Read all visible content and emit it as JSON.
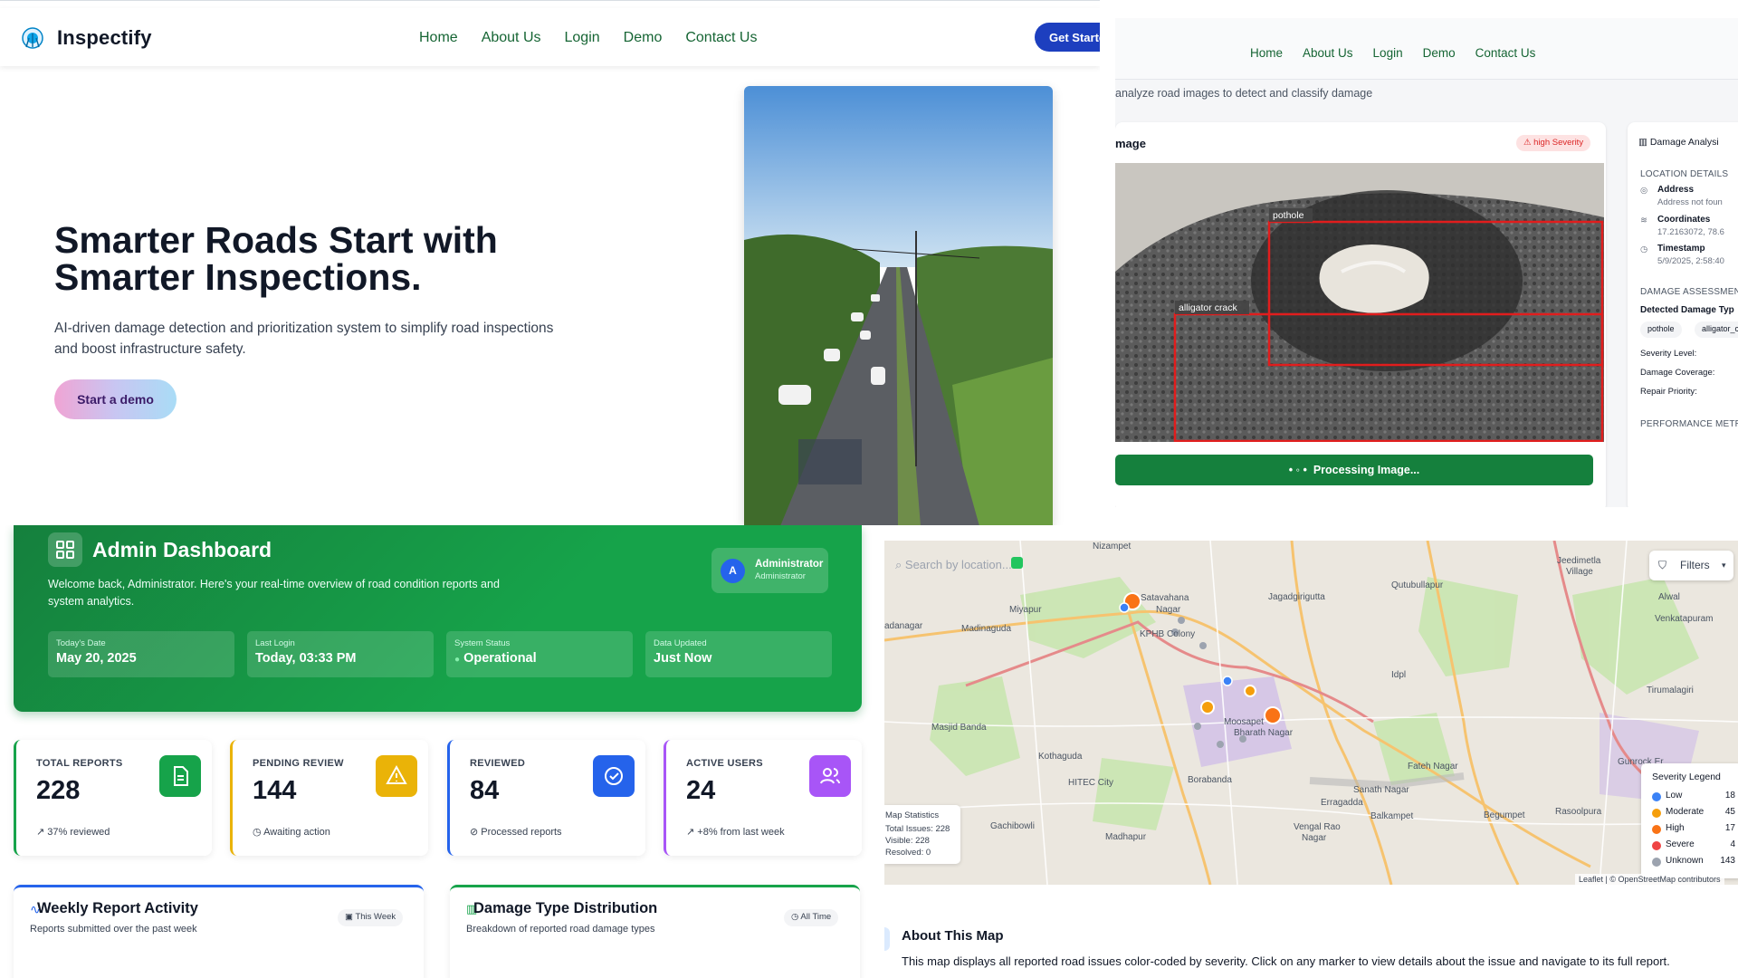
{
  "landing": {
    "brand": "Inspectify",
    "nav": [
      "Home",
      "About Us",
      "Login",
      "Demo",
      "Contact Us"
    ],
    "get_started": "Get Started",
    "hero_title": "Smarter Roads Start with Smarter Inspections.",
    "hero_subtitle": "AI-driven damage detection and prioritization system to simplify road inspections and boost infrastructure safety.",
    "demo_button": "Start a demo"
  },
  "analysis": {
    "nav": [
      "Home",
      "About Us",
      "Login",
      "Demo",
      "Contact Us"
    ],
    "subtitle": "analyze road images to detect and classify damage",
    "image_card_title": "mage",
    "severity_badge": "high Severity",
    "labels": {
      "pothole": "pothole",
      "alligator": "alligator crack"
    },
    "processing": "Processing Image...",
    "side": {
      "title": "Damage Analysi",
      "location_header": "LOCATION DETAILS",
      "address_label": "Address",
      "address_value": "Address not foun",
      "coords_label": "Coordinates",
      "coords_value": "17.2163072, 78.6",
      "timestamp_label": "Timestamp",
      "timestamp_value": "5/9/2025, 2:58:40",
      "assessment_header": "DAMAGE ASSESSMEN",
      "detected_label": "Detected Damage Typ",
      "chips": [
        "pothole",
        "alligator_c"
      ],
      "severity_level": "Severity Level:",
      "coverage": "Damage Coverage:",
      "priority": "Repair Priority:",
      "performance_header": "PERFORMANCE METR"
    }
  },
  "admin": {
    "title": "Admin Dashboard",
    "welcome": "Welcome back, Administrator. Here's your real-time overview of road condition reports and system analytics.",
    "user": {
      "initial": "A",
      "name": "Administrator",
      "role": "Administrator"
    },
    "info": [
      {
        "label": "Today's Date",
        "value": "May 20, 2025"
      },
      {
        "label": "Last Login",
        "value": "Today, 03:33 PM"
      },
      {
        "label": "System Status",
        "value": "Operational"
      },
      {
        "label": "Data Updated",
        "value": "Just Now"
      }
    ],
    "stats": [
      {
        "label": "TOTAL REPORTS",
        "value": "228",
        "foot": "37% reviewed",
        "color": "#16a34a"
      },
      {
        "label": "PENDING REVIEW",
        "value": "144",
        "foot": "Awaiting action",
        "color": "#eab308"
      },
      {
        "label": "REVIEWED",
        "value": "84",
        "foot": "Processed reports",
        "color": "#2563eb"
      },
      {
        "label": "ACTIVE USERS",
        "value": "24",
        "foot": "+8% from last week",
        "color": "#a855f7"
      }
    ],
    "weekly": {
      "title": "Weekly Report Activity",
      "subtitle": "Reports submitted over the past week",
      "badge": "This Week"
    },
    "distribution": {
      "title": "Damage Type Distribution",
      "subtitle": "Breakdown of reported road damage types",
      "badge": "All Time"
    }
  },
  "map": {
    "search_placeholder": "Search by location...",
    "filters": "Filters",
    "places": [
      "Nizampet",
      "Jeedimetla Village",
      "Satavahana Nagar",
      "Jagadgirigutta",
      "Qutubullapur",
      "Alwal",
      "Miyapur",
      "Venkatapuram",
      "Madinaguda",
      "KPHB Colony",
      "Idpl",
      "Masjid Banda",
      "Moosapet",
      "Bharath Nagar",
      "Tirumalagiri",
      "Kothaguda",
      "Fateh Nagar",
      "HITEC City",
      "Borabanda",
      "Sanath Nagar",
      "Erragadda",
      "Begumpet",
      "Rasoolpura",
      "Gachibowli",
      "Madhapur",
      "Balkampet",
      "Gunrock Er",
      "Vengal Rao Nagar",
      "adanagar"
    ],
    "stats": {
      "title": "Map Statistics",
      "total": "Total Issues: 228",
      "visible": "Visible: 228",
      "resolved": "Resolved: 0"
    },
    "legend_title": "Severity Legend",
    "legend": [
      {
        "name": "Low",
        "count": "18",
        "color": "#3b82f6"
      },
      {
        "name": "Moderate",
        "count": "45",
        "color": "#f59e0b"
      },
      {
        "name": "High",
        "count": "17",
        "color": "#f97316"
      },
      {
        "name": "Severe",
        "count": "4",
        "color": "#ef4444"
      },
      {
        "name": "Unknown",
        "count": "143",
        "color": "#9ca3af"
      }
    ],
    "attribution": "Leaflet | © OpenStreetMap contributors",
    "about_title": "About This Map",
    "about_text": "This map displays all reported road issues color-coded by severity. Click on any marker to view details about the issue and navigate to its full report."
  }
}
